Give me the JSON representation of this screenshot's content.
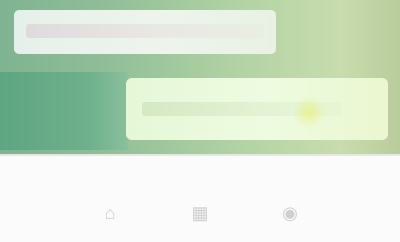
{
  "header": {
    "title": ""
  },
  "panel": {
    "text": ""
  },
  "bottom_nav": {
    "items": [
      {
        "icon": "home-icon",
        "label": ""
      },
      {
        "icon": "grid-icon",
        "label": ""
      },
      {
        "icon": "profile-icon",
        "label": ""
      }
    ]
  }
}
